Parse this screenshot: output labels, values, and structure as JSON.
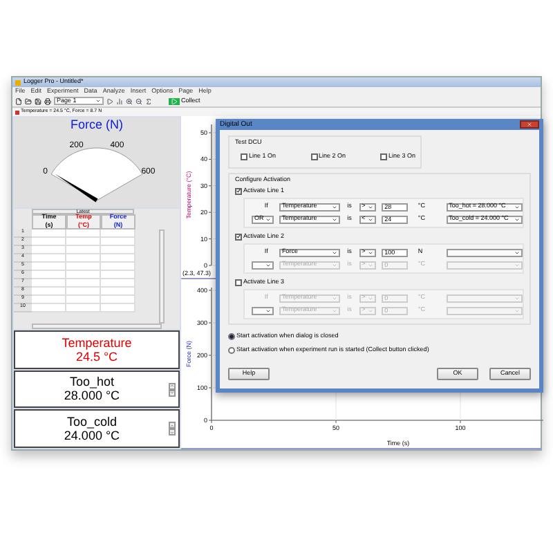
{
  "window": {
    "title": "Logger Pro - Untitled*"
  },
  "menu": [
    "File",
    "Edit",
    "Experiment",
    "Data",
    "Analyze",
    "Insert",
    "Options",
    "Page",
    "Help"
  ],
  "toolbar": {
    "page": "Page 1",
    "collect": "Collect"
  },
  "status": "Temperature = 24.5 °C, Force = 8.7 N",
  "meter": {
    "title": "Force (N)",
    "ticks": [
      "0",
      "200",
      "400",
      "600"
    ],
    "level": 0.02
  },
  "table": {
    "group": "Latest",
    "columns": [
      {
        "name": "Time",
        "unit": "(s)",
        "color": "#000000"
      },
      {
        "name": "Temp",
        "unit": "(°C)",
        "color": "#e00000"
      },
      {
        "name": "Force",
        "unit": "(N)",
        "color": "#1020d0"
      }
    ],
    "rows": [
      "1",
      "2",
      "3",
      "4",
      "5",
      "6",
      "7",
      "8",
      "9",
      "10"
    ]
  },
  "temperature_meter": {
    "label": "Temperature",
    "value": "24.5 °C"
  },
  "parameters": [
    {
      "name": "Too_hot",
      "value": "28.000 °C"
    },
    {
      "name": "Too_cold",
      "value": "24.000 °C"
    }
  ],
  "graphs": [
    {
      "ylabel": "Temperature (°C)",
      "yticks": [
        "50",
        "40",
        "30",
        "20",
        "10",
        "0"
      ],
      "readout": "(2.3, 47.3)"
    },
    {
      "ylabel": "Force (N)",
      "yticks": [
        "400",
        "300",
        "200",
        "100",
        "0"
      ],
      "xticks": [
        "0",
        "50",
        "100"
      ],
      "xlabel": "Time (s)"
    }
  ],
  "dialog": {
    "title": "Digital Out",
    "test_group": "Test DCU",
    "test_lines": [
      {
        "label": "Line 1 On",
        "checked": false
      },
      {
        "label": "Line 2 On",
        "checked": false
      },
      {
        "label": "Line 3 On",
        "checked": false
      }
    ],
    "configure_group": "Configure Activation",
    "lines": [
      {
        "label": "Activate Line 1",
        "checked": true,
        "conditions": [
          {
            "joiner": "If",
            "sensor": "Temperature",
            "is": "is",
            "op": ">",
            "value": "28",
            "unit": "°C",
            "parameter": "Too_hot = 28.000 °C",
            "disabled": false
          },
          {
            "joiner": "OR",
            "sensor": "Temperature",
            "is": "is",
            "op": "<",
            "value": "24",
            "unit": "°C",
            "parameter": "Too_cold = 24.000 °C",
            "disabled": false
          }
        ]
      },
      {
        "label": "Activate Line 2",
        "checked": true,
        "conditions": [
          {
            "joiner": "If",
            "sensor": "Force",
            "is": "is",
            "op": ">",
            "value": "100",
            "unit": "N",
            "disabled": false
          },
          {
            "sensor": "Temperature",
            "is": "is",
            "op": ">",
            "value": "0",
            "unit": "°C",
            "disabled": true
          }
        ]
      },
      {
        "label": "Activate Line 3",
        "checked": false,
        "conditions": [
          {
            "joiner": "If",
            "sensor": "Temperature",
            "is": "is",
            "op": ">",
            "value": "0",
            "unit": "°C",
            "disabled": true
          },
          {
            "sensor": "Temperature",
            "is": "is",
            "op": ">",
            "value": "0",
            "unit": "°C",
            "disabled": true
          }
        ]
      }
    ],
    "radios": [
      {
        "label": "Start activation when dialog is closed",
        "selected": true
      },
      {
        "label": "Start activation when experiment run is started (Collect button clicked)",
        "selected": false
      }
    ],
    "buttons": [
      "Help",
      "OK",
      "Cancel"
    ]
  }
}
